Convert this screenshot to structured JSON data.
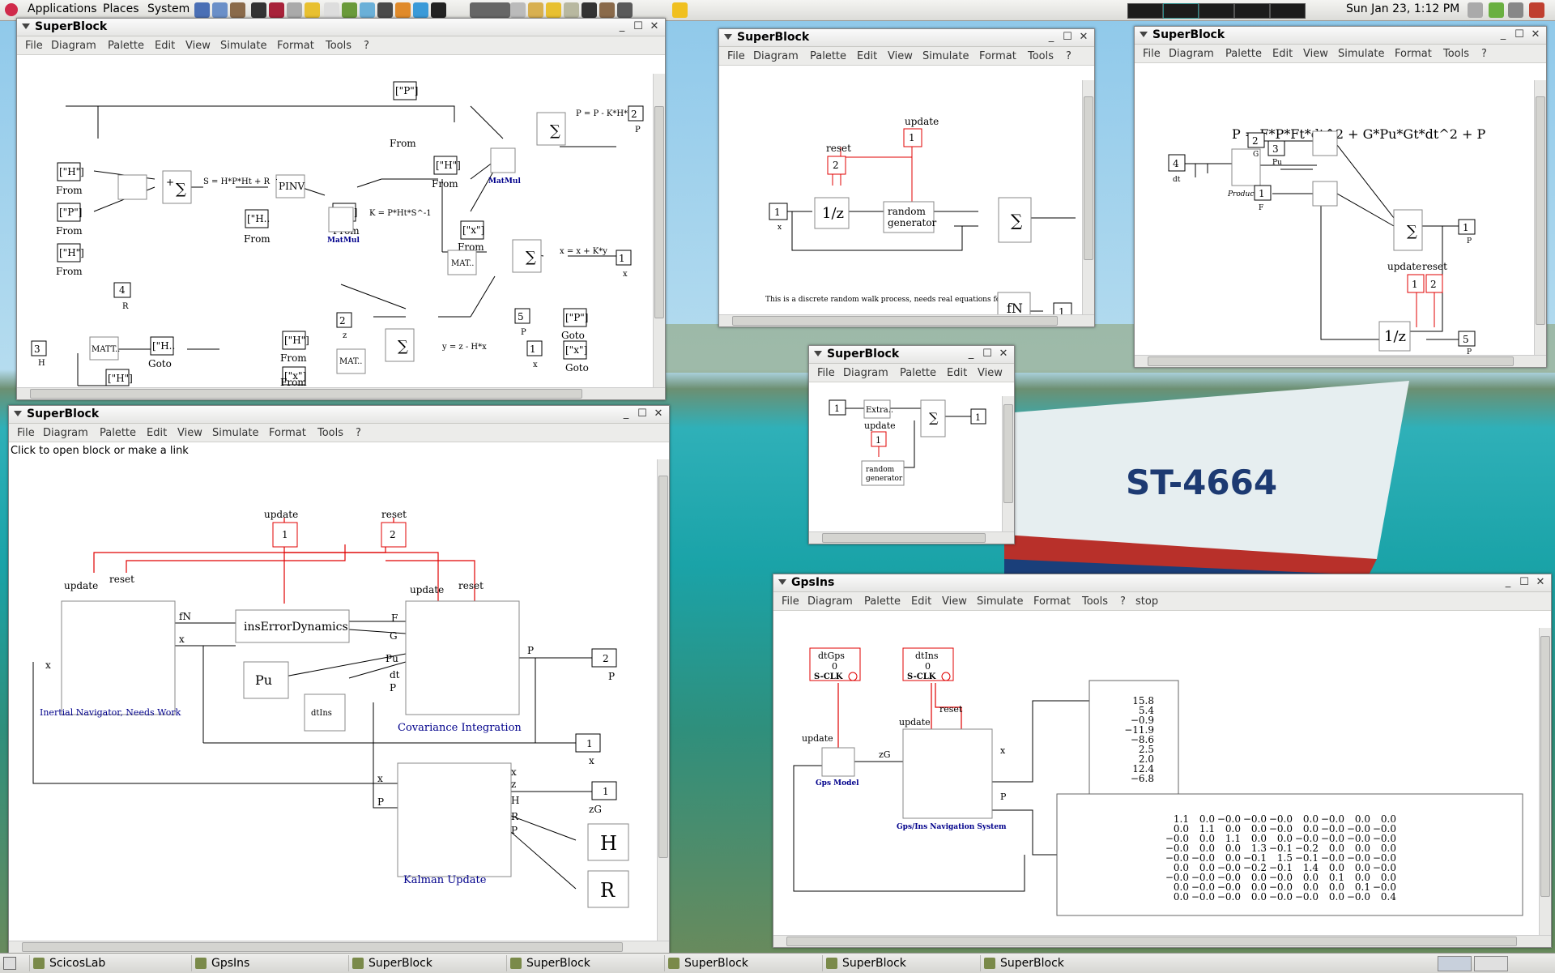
{
  "topbar": {
    "menus": [
      "Applications",
      "Places",
      "System"
    ],
    "clock": "Sun Jan 23,  1:12 PM"
  },
  "taskbar": {
    "items": [
      "ScicosLab",
      "GpsIns",
      "SuperBlock",
      "SuperBlock",
      "SuperBlock",
      "SuperBlock",
      "SuperBlock"
    ]
  },
  "std_menu": [
    "File",
    "Diagram",
    "Palette",
    "Edit",
    "View",
    "Simulate",
    "Format",
    "Tools",
    "?"
  ],
  "gps_menu": [
    "File",
    "Diagram",
    "Palette",
    "Edit",
    "View",
    "Simulate",
    "Format",
    "Tools",
    "?",
    "stop"
  ],
  "small_menu": [
    "File",
    "Diagram",
    "Palette",
    "Edit",
    "View"
  ],
  "w1": {
    "title": "SuperBlock",
    "labels": {
      "from_h1": "[\"H\"]",
      "from_p1": "[\"P\"]",
      "from_h2": "[\"H\"]",
      "from_lbl": "From",
      "r_port": "4",
      "r_lbl": "R",
      "s_eq": "S = H*P*Ht + R",
      "pinv": "PINV",
      "from_p2": "[\"P\"]",
      "from_h3": "[\"H..",
      "matmul": "MatMul",
      "k_eq": "K = P*Ht*S^-1",
      "from_p3": "[\"P\"]",
      "from_h4": "[\"H\"]",
      "p_eq": "P = P - K*H*P",
      "out2": "2",
      "p_lbl": "P",
      "from_x": "[\"x\"]",
      "matt": "MAT..",
      "x_eq": "x = x + K*y",
      "out1": "1",
      "x_lbl": "x",
      "z_port": "2",
      "z_lbl": "z",
      "from_h5": "[\"H\"]",
      "from_x2": "[\"x\"]",
      "y_eq": "y = z - H*x",
      "in5": "5",
      "in1": "1",
      "goto_p": "[\"P\"]",
      "goto_x": "[\"x\"]",
      "goto": "Goto",
      "in3": "3",
      "h_lbl": "H",
      "matt2": "MATT..",
      "goto_h": "[\"H..",
      "goto_h2": "[\"H\"]",
      "plus": "+",
      "minus": "-"
    }
  },
  "w2": {
    "title": "SuperBlock",
    "labels": {
      "update": "update",
      "reset": "reset",
      "one": "1",
      "two": "2",
      "delay": "1/z",
      "rg1": "random",
      "rg2": "generator",
      "note": "This is a discrete random walk process, needs real equations for ins",
      "fn": "fN",
      "out1": "1",
      "x_lbl": "x",
      "fn_lbl": "fN"
    }
  },
  "w3": {
    "title": "SuperBlock",
    "labels": {
      "eq": "P = F*P*Ft*dt^2 + G*Pu*Gt*dt^2 + P",
      "in4": "4",
      "dt": "dt",
      "in2": "2",
      "g": "G",
      "in3": "3",
      "pu": "Pu",
      "in1": "1",
      "f": "F",
      "product": "Product",
      "out1": "1",
      "p": "P",
      "update": "update",
      "reset": "reset",
      "one": "1",
      "two": "2",
      "delay": "1/z",
      "in5": "5"
    }
  },
  "w4": {
    "title": "SuperBlock",
    "labels": {
      "in1": "1",
      "extra": "Extra..",
      "update": "update",
      "one": "1",
      "out1": "1",
      "rg1": "random",
      "rg2": "generator"
    }
  },
  "w5": {
    "title": "SuperBlock",
    "status": "Click to open block or make a link",
    "labels": {
      "update": "update",
      "reset": "reset",
      "one": "1",
      "two": "2",
      "inav": "Inertial Navigator, Needs Work",
      "fn": "fN",
      "x": "x",
      "ins": "insErrorDynamics",
      "pu": "Pu",
      "dtins": "dtIns",
      "F": "F",
      "G": "G",
      "Pu": "Pu",
      "dt": "dt",
      "P": "P",
      "cov": "Covariance Integration",
      "out2": "2",
      "out1": "1",
      "kal": "Kalman Update",
      "z": "z",
      "H": "H",
      "R": "R",
      "zG": "zG",
      "hblk": "H",
      "rblk": "R"
    }
  },
  "w6": {
    "title": "GpsIns",
    "labels": {
      "dtgps": "dtGps",
      "dtins": "dtIns",
      "zero": "0",
      "sclk": "S-CLK",
      "update": "update",
      "reset": "reset",
      "gpsmodel": "Gps Model",
      "zG": "zG",
      "nav": "Gps/Ins Navigation System",
      "x": "x",
      "P": "P"
    },
    "vector": [
      "15.8",
      "5.4",
      "−0.9",
      "−11.9",
      "−8.6",
      "2.5",
      "2.0",
      "12.4",
      "−6.8"
    ],
    "matrix": [
      [
        "1.1",
        "0.0",
        "−0.0",
        "−0.0",
        "−0.0",
        "0.0",
        "−0.0",
        "0.0",
        "0.0"
      ],
      [
        "0.0",
        "1.1",
        "0.0",
        "0.0",
        "−0.0",
        "0.0",
        "−0.0",
        "−0.0",
        "−0.0"
      ],
      [
        "−0.0",
        "0.0",
        "1.1",
        "0.0",
        "0.0",
        "−0.0",
        "−0.0",
        "−0.0",
        "−0.0"
      ],
      [
        "−0.0",
        "0.0",
        "0.0",
        "1.3",
        "−0.1",
        "−0.2",
        "0.0",
        "0.0",
        "0.0"
      ],
      [
        "−0.0",
        "−0.0",
        "0.0",
        "−0.1",
        "1.5",
        "−0.1",
        "−0.0",
        "−0.0",
        "−0.0"
      ],
      [
        "0.0",
        "0.0",
        "−0.0",
        "−0.2",
        "−0.1",
        "1.4",
        "0.0",
        "0.0",
        "−0.0"
      ],
      [
        "−0.0",
        "−0.0",
        "−0.0",
        "0.0",
        "−0.0",
        "0.0",
        "0.1",
        "0.0",
        "0.0"
      ],
      [
        "0.0",
        "−0.0",
        "−0.0",
        "0.0",
        "−0.0",
        "0.0",
        "0.0",
        "0.1",
        "−0.0"
      ],
      [
        "0.0",
        "−0.0",
        "−0.0",
        "0.0",
        "−0.0",
        "−0.0",
        "0.0",
        "−0.0",
        "0.4"
      ]
    ]
  },
  "boat": {
    "label": "ST-4664"
  }
}
